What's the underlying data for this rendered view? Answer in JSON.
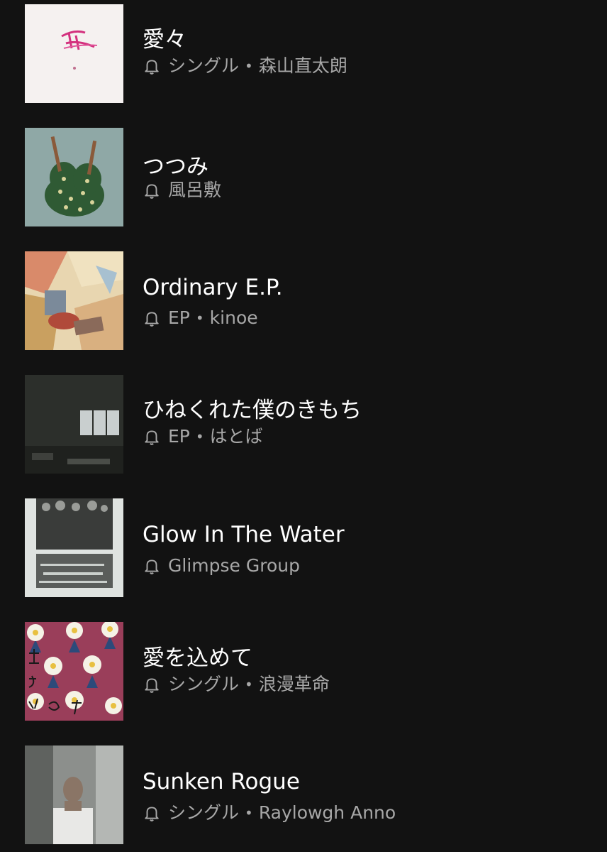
{
  "releases": [
    {
      "title": "愛々",
      "type": "シングル",
      "artist": "森山直太朗"
    },
    {
      "title": "つつみ",
      "type": "",
      "artist": "風呂敷"
    },
    {
      "title": "Ordinary E.P.",
      "type": "EP",
      "artist": "kinoe"
    },
    {
      "title": "ひねくれた僕のきもち",
      "type": "EP",
      "artist": "はとば"
    },
    {
      "title": "Glow In The Water",
      "type": "",
      "artist": "Glimpse Group"
    },
    {
      "title": "愛を込めて",
      "type": "シングル",
      "artist": "浪漫革命"
    },
    {
      "title": "Sunken Rogue",
      "type": "シングル",
      "artist": "Raylowgh Anno"
    }
  ],
  "separator": "•",
  "icons": {
    "notification": "bell-icon"
  },
  "colors": {
    "background": "#121212",
    "title": "#ffffff",
    "subtitle": "#a7a7a7"
  }
}
